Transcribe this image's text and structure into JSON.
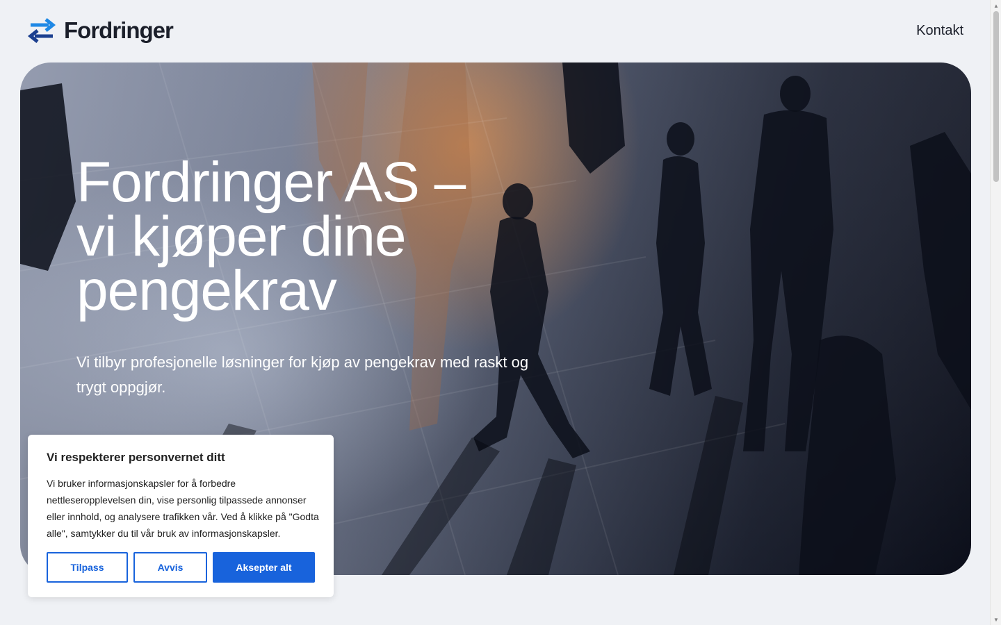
{
  "header": {
    "brand": "Fordringer",
    "contact_label": "Kontakt",
    "logo_icon": "swap-arrows-icon",
    "brand_colors": {
      "arrow_top": "#1e88e5",
      "arrow_bottom": "#1b3f8f"
    }
  },
  "hero": {
    "title_line1": "Fordringer AS –",
    "title_line2": "vi kjøper dine",
    "title_line3": "pengekrav",
    "subtitle": "Vi tilbyr profesjonelle løsninger for kjøp av pengekrav med raskt og trygt oppgjør."
  },
  "cookie": {
    "title": "Vi respekterer personvernet ditt",
    "text": "Vi bruker informasjonskapsler for å forbedre nettleseropplevelsen din, vise personlig tilpassede annonser eller innhold, og analysere trafikken vår. Ved å klikke på \"Godta alle\", samtykker du til vår bruk av informasjonskapsler.",
    "customize_label": "Tilpass",
    "reject_label": "Avvis",
    "accept_label": "Aksepter alt",
    "accent_color": "#1863dc"
  }
}
